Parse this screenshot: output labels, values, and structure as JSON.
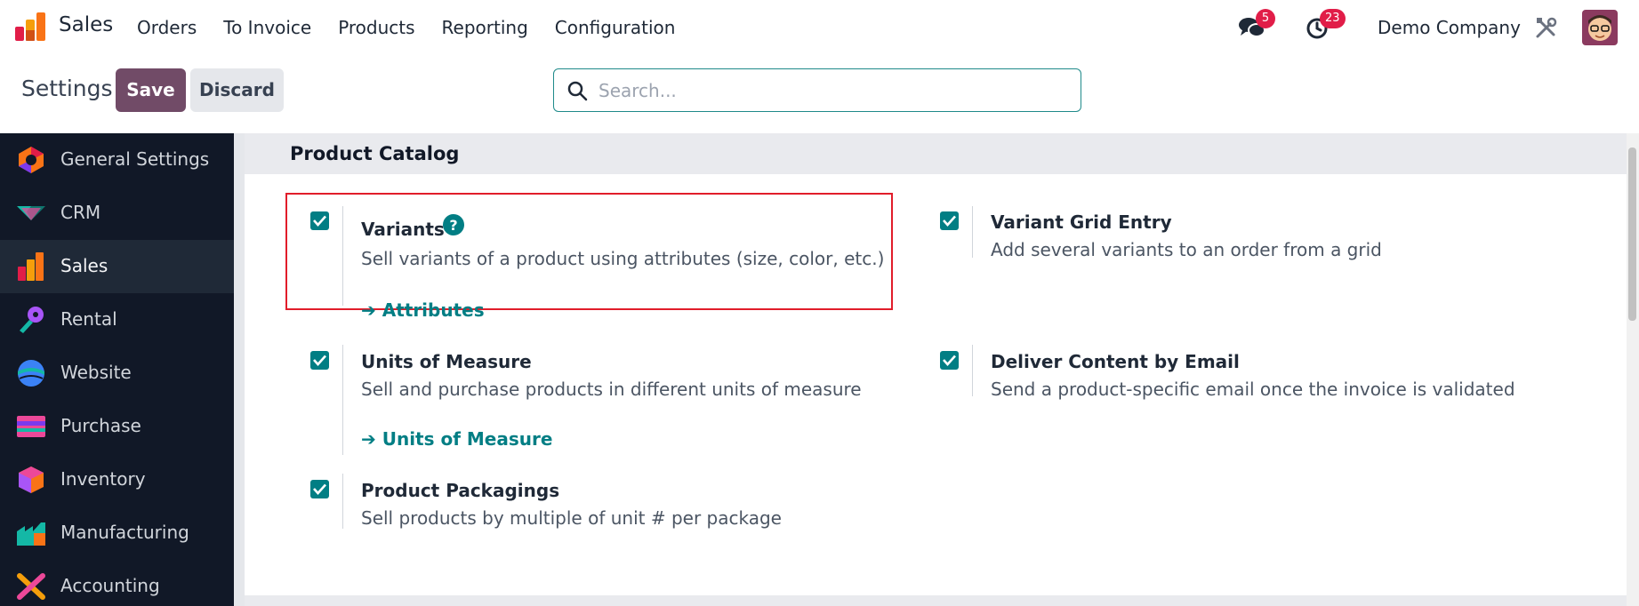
{
  "navbar": {
    "brand": "Sales",
    "menu": [
      "Orders",
      "To Invoice",
      "Products",
      "Reporting",
      "Configuration"
    ],
    "messages_count": "5",
    "activities_count": "23",
    "company": "Demo Company"
  },
  "control": {
    "title": "Settings",
    "save_label": "Save",
    "discard_label": "Discard",
    "search_placeholder": "Search..."
  },
  "sidebar": {
    "items": [
      {
        "label": "General Settings",
        "icon": "general-settings-icon"
      },
      {
        "label": "CRM",
        "icon": "crm-icon"
      },
      {
        "label": "Sales",
        "icon": "sales-icon",
        "active": true
      },
      {
        "label": "Rental",
        "icon": "rental-icon"
      },
      {
        "label": "Website",
        "icon": "website-icon"
      },
      {
        "label": "Purchase",
        "icon": "purchase-icon"
      },
      {
        "label": "Inventory",
        "icon": "inventory-icon"
      },
      {
        "label": "Manufacturing",
        "icon": "manufacturing-icon"
      },
      {
        "label": "Accounting",
        "icon": "accounting-icon"
      }
    ]
  },
  "section": {
    "title": "Product Catalog",
    "settings": [
      {
        "title": "Variants",
        "description": "Sell variants of a product using attributes (size, color, etc.)",
        "link": "➔ Attributes",
        "checked": true
      },
      {
        "title": "Variant Grid Entry",
        "description": "Add several variants to an order from a grid",
        "checked": true
      },
      {
        "title": "Units of Measure",
        "description": "Sell and purchase products in different units of measure",
        "link": "➔ Units of Measure",
        "checked": true
      },
      {
        "title": "Deliver Content by Email",
        "description": "Send a product-specific email once the invoice is validated",
        "checked": true
      },
      {
        "title": "Product Packagings",
        "description": "Sell products by multiple of unit # per package",
        "checked": true
      }
    ]
  },
  "colors": {
    "primary": "#714b67",
    "accent": "#017e84",
    "highlight": "#e11d2a",
    "badge": "#e11d48"
  }
}
